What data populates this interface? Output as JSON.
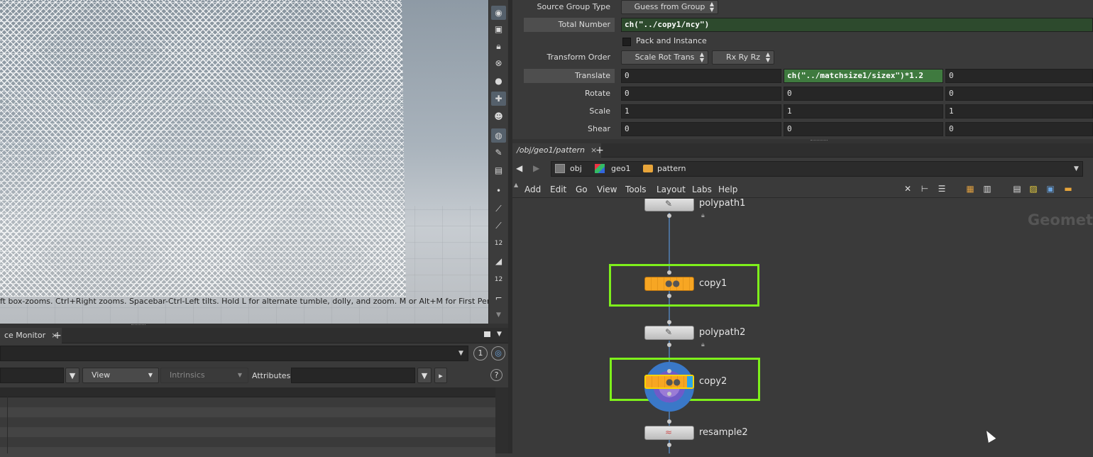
{
  "viewport": {
    "hint_text": "ft box-zooms. Ctrl+Right zooms. Spacebar-Ctrl-Left tilts. Hold L for alternate tumble, dolly, and zoom. M or Alt+M for First Person"
  },
  "viewport_tools": [
    "camera-icon",
    "display-icon",
    "lock-icon",
    "ghost-icon",
    "sphere-icon",
    "snap-icon",
    "skull-icon",
    "render-icon",
    "brush-icon",
    "light-icon",
    "dot-icon",
    "pen-icon",
    "pipette-icon",
    "counter-icon",
    "eraser-icon",
    "grid-icon",
    "corner-icon",
    "scroll-down-icon"
  ],
  "viewport_tool_labels": {
    "counter1": "12",
    "counter2": "12"
  },
  "lower_left": {
    "tab_label": "ce Monitor",
    "tab_close": "×",
    "add_tab": "+",
    "view_combo": "View",
    "intrinsics_combo": "Intrinsics",
    "attributes_label": "Attributes:",
    "circle_number": "1",
    "help": "?"
  },
  "params": {
    "source_group_type": {
      "label": "Source Group Type",
      "value": "Guess from Group"
    },
    "total_number": {
      "label": "Total Number",
      "value": "ch(\"../copy1/ncy\")"
    },
    "pack_and_instance": {
      "label": "Pack and Instance"
    },
    "transform_order": {
      "label": "Transform Order",
      "value": "Scale Rot Trans",
      "rot_value": "Rx Ry Rz"
    },
    "translate": {
      "label": "Translate",
      "x": "0",
      "y": "ch(\"../matchsize1/sizex\")*1.2",
      "z": "0"
    },
    "rotate": {
      "label": "Rotate",
      "x": "0",
      "y": "0",
      "z": "0"
    },
    "scale": {
      "label": "Scale",
      "x": "1",
      "y": "1",
      "z": "1"
    },
    "shear": {
      "label": "Shear",
      "x": "0",
      "y": "0",
      "z": "0"
    }
  },
  "network": {
    "tab_label": "/obj/geo1/pattern",
    "tab_close": "×",
    "add_tab": "+",
    "breadcrumbs": [
      "obj",
      "geo1",
      "pattern"
    ],
    "menus": [
      "Add",
      "Edit",
      "Go",
      "View",
      "Tools",
      "Layout",
      "Labs",
      "Help"
    ],
    "context_label": "Geomet",
    "nodes": [
      {
        "name": "polypath1",
        "type": "gray"
      },
      {
        "name": "copy1",
        "type": "orange"
      },
      {
        "name": "polypath2",
        "type": "gray"
      },
      {
        "name": "copy2",
        "type": "orange"
      },
      {
        "name": "resample2",
        "type": "gray"
      }
    ]
  },
  "colors": {
    "selection": "#7ef01b",
    "node_orange": "#f7a623",
    "wire": "#4c6f96",
    "expression_field": "#3f7a3f"
  }
}
